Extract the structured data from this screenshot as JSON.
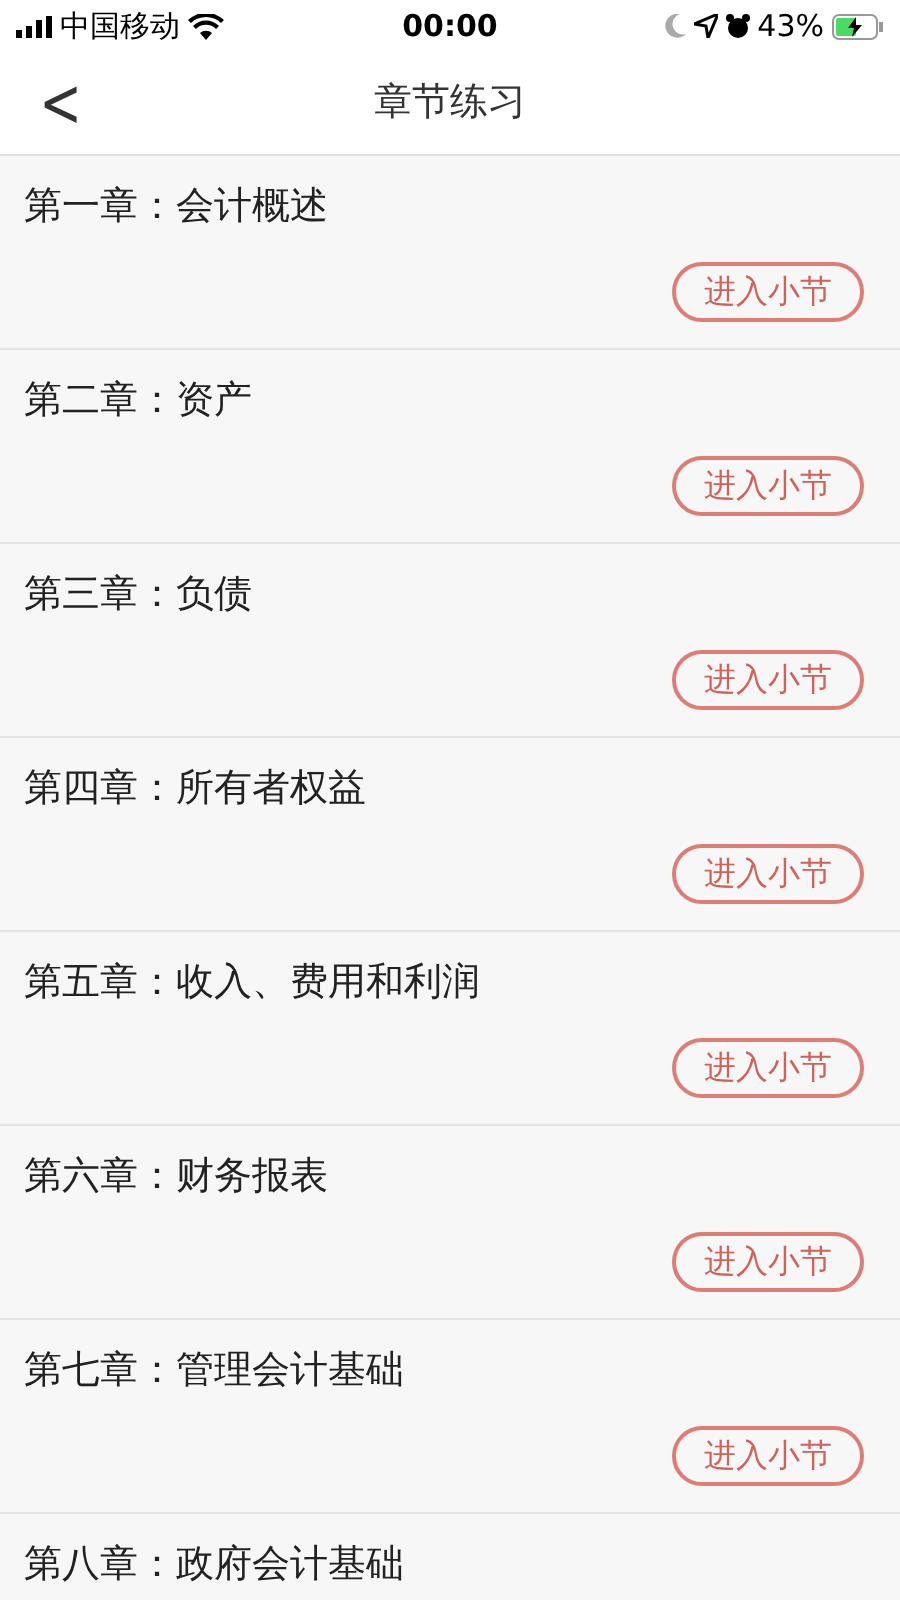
{
  "status_bar": {
    "carrier": "中国移动",
    "time": "00:00",
    "battery": "43%"
  },
  "nav": {
    "back": "<",
    "title": "章节练习"
  },
  "chapters": [
    {
      "title": "第一章：会计概述",
      "button": "进入小节"
    },
    {
      "title": "第二章：资产",
      "button": "进入小节"
    },
    {
      "title": "第三章：负债",
      "button": "进入小节"
    },
    {
      "title": "第四章：所有者权益",
      "button": "进入小节"
    },
    {
      "title": "第五章：收入、费用和利润",
      "button": "进入小节"
    },
    {
      "title": "第六章：财务报表",
      "button": "进入小节"
    },
    {
      "title": "第七章：管理会计基础",
      "button": "进入小节"
    },
    {
      "title": "第八章：政府会计基础"
    }
  ]
}
